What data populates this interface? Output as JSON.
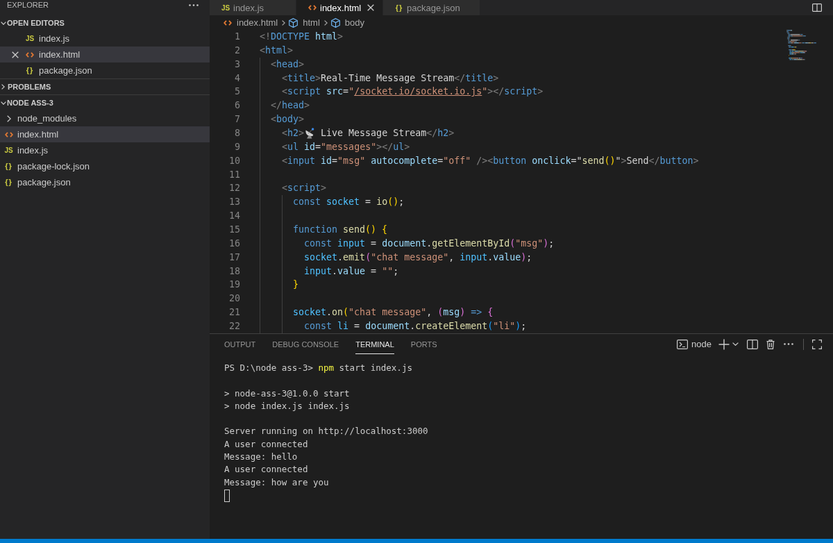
{
  "sidebar": {
    "title": "EXPLORER",
    "sections": [
      {
        "kind": "editors",
        "title": "OPEN EDITORS",
        "expanded": true,
        "items": [
          {
            "kind": "js",
            "icon": "JS",
            "name": "index.js",
            "selected": false
          },
          {
            "kind": "html",
            "name": "index.html",
            "selected": true
          },
          {
            "kind": "json",
            "icon": "{}",
            "name": "package.json",
            "selected": false
          }
        ]
      },
      {
        "kind": "problems",
        "title": "PROBLEMS",
        "expanded": false
      },
      {
        "kind": "tree",
        "title": "NODE ASS-3",
        "expanded": true,
        "items": [
          {
            "kind": "folder",
            "name": "node_modules",
            "expanded": false,
            "selected": false
          },
          {
            "kind": "html",
            "name": "index.html",
            "selected": true
          },
          {
            "kind": "js",
            "icon": "JS",
            "name": "index.js",
            "selected": false
          },
          {
            "kind": "json",
            "icon": "{}",
            "name": "package-lock.json",
            "selected": false
          },
          {
            "kind": "json",
            "icon": "{}",
            "name": "package.json",
            "selected": false
          }
        ]
      }
    ]
  },
  "editor": {
    "tabs": [
      {
        "kind": "js",
        "icon": "JS",
        "label": "index.js",
        "selected": false
      },
      {
        "kind": "html",
        "label": "index.html",
        "selected": true
      },
      {
        "kind": "json",
        "icon": "{}",
        "label": "package.json",
        "selected": false
      }
    ],
    "breadcrumbs": [
      {
        "kind": "file",
        "label": "index.html"
      },
      {
        "kind": "element",
        "label": "html"
      },
      {
        "kind": "element",
        "label": "body"
      }
    ],
    "code": [
      {
        "n": "1",
        "segments": [
          {
            "kind": "p",
            "text": "<!"
          },
          {
            "kind": "tag",
            "text": "DOCTYPE"
          },
          {
            "kind": "attr",
            "text": " html"
          },
          {
            "kind": "p",
            "text": ">"
          }
        ]
      },
      {
        "n": "2",
        "segments": [
          {
            "kind": "p",
            "text": "<"
          },
          {
            "kind": "tag",
            "text": "html"
          },
          {
            "kind": "p",
            "text": ">"
          }
        ]
      },
      {
        "n": "3",
        "segments": [
          {
            "kind": "p",
            "text": "  <"
          },
          {
            "kind": "tag",
            "text": "head"
          },
          {
            "kind": "p",
            "text": ">"
          }
        ]
      },
      {
        "n": "4",
        "segments": [
          {
            "kind": "p",
            "text": "    <"
          },
          {
            "kind": "tag",
            "text": "title"
          },
          {
            "kind": "p",
            "text": ">"
          },
          {
            "kind": "text",
            "text": "Real-Time Message Stream"
          },
          {
            "kind": "p",
            "text": "</"
          },
          {
            "kind": "tag",
            "text": "title"
          },
          {
            "kind": "p",
            "text": ">"
          }
        ]
      },
      {
        "n": "5",
        "segments": [
          {
            "kind": "p",
            "text": "    <"
          },
          {
            "kind": "tag",
            "text": "script"
          },
          {
            "kind": "attr",
            "text": " src"
          },
          {
            "kind": "op",
            "text": "="
          },
          {
            "kind": "str",
            "text": "\""
          },
          {
            "kind": "link",
            "text": "/socket.io/socket.io.js"
          },
          {
            "kind": "str",
            "text": "\""
          },
          {
            "kind": "p",
            "text": "></"
          },
          {
            "kind": "tag",
            "text": "script"
          },
          {
            "kind": "p",
            "text": ">"
          }
        ]
      },
      {
        "n": "6",
        "segments": [
          {
            "kind": "p",
            "text": "  </"
          },
          {
            "kind": "tag",
            "text": "head"
          },
          {
            "kind": "p",
            "text": ">"
          }
        ]
      },
      {
        "n": "7",
        "segments": [
          {
            "kind": "p",
            "text": "  <"
          },
          {
            "kind": "tag",
            "text": "body"
          },
          {
            "kind": "p",
            "text": ">"
          }
        ]
      },
      {
        "n": "8",
        "segments": [
          {
            "kind": "p",
            "text": "    <"
          },
          {
            "kind": "tag",
            "text": "h2"
          },
          {
            "kind": "p",
            "text": ">"
          },
          {
            "kind": "icon"
          },
          {
            "kind": "text",
            "text": " Live Message Stream"
          },
          {
            "kind": "p",
            "text": "</"
          },
          {
            "kind": "tag",
            "text": "h2"
          },
          {
            "kind": "p",
            "text": ">"
          }
        ]
      },
      {
        "n": "9",
        "segments": [
          {
            "kind": "p",
            "text": "    <"
          },
          {
            "kind": "tag",
            "text": "ul"
          },
          {
            "kind": "attr",
            "text": " id"
          },
          {
            "kind": "op",
            "text": "="
          },
          {
            "kind": "str",
            "text": "\"messages\""
          },
          {
            "kind": "p",
            "text": "></"
          },
          {
            "kind": "tag",
            "text": "ul"
          },
          {
            "kind": "p",
            "text": ">"
          }
        ]
      },
      {
        "n": "10",
        "segments": [
          {
            "kind": "p",
            "text": "    <"
          },
          {
            "kind": "tag",
            "text": "input"
          },
          {
            "kind": "attr",
            "text": " id"
          },
          {
            "kind": "op",
            "text": "="
          },
          {
            "kind": "str",
            "text": "\"msg\""
          },
          {
            "kind": "attr",
            "text": " autocomplete"
          },
          {
            "kind": "op",
            "text": "="
          },
          {
            "kind": "str",
            "text": "\"off\""
          },
          {
            "kind": "p",
            "text": " /><"
          },
          {
            "kind": "tag",
            "text": "button"
          },
          {
            "kind": "attr",
            "text": " onclick"
          },
          {
            "kind": "op",
            "text": "=\""
          },
          {
            "kind": "fn",
            "text": "send"
          },
          {
            "kind": "b1",
            "text": "()"
          },
          {
            "kind": "op",
            "text": "\""
          },
          {
            "kind": "p",
            "text": ">"
          },
          {
            "kind": "text",
            "text": "Send"
          },
          {
            "kind": "p",
            "text": "</"
          },
          {
            "kind": "tag",
            "text": "button"
          },
          {
            "kind": "p",
            "text": ">"
          }
        ]
      },
      {
        "n": "11"
      },
      {
        "n": "12",
        "segments": [
          {
            "kind": "p",
            "text": "    <"
          },
          {
            "kind": "tag",
            "text": "script"
          },
          {
            "kind": "p",
            "text": ">"
          }
        ]
      },
      {
        "n": "13",
        "segments": [
          {
            "kind": "kw",
            "text": "      const"
          },
          {
            "kind": "cvar",
            "text": " socket"
          },
          {
            "kind": "op",
            "text": " = "
          },
          {
            "kind": "fn",
            "text": "io"
          },
          {
            "kind": "b1",
            "text": "()"
          },
          {
            "kind": "op",
            "text": ";"
          }
        ]
      },
      {
        "n": "14"
      },
      {
        "n": "15",
        "segments": [
          {
            "kind": "kw",
            "text": "      function"
          },
          {
            "kind": "fn",
            "text": " send"
          },
          {
            "kind": "b1",
            "text": "() {"
          }
        ]
      },
      {
        "n": "16",
        "segments": [
          {
            "kind": "kw",
            "text": "        const"
          },
          {
            "kind": "cvar",
            "text": " input"
          },
          {
            "kind": "op",
            "text": " = "
          },
          {
            "kind": "var",
            "text": "document"
          },
          {
            "kind": "op",
            "text": "."
          },
          {
            "kind": "fn",
            "text": "getElementById"
          },
          {
            "kind": "b2",
            "text": "("
          },
          {
            "kind": "str",
            "text": "\"msg\""
          },
          {
            "kind": "b2",
            "text": ")"
          },
          {
            "kind": "op",
            "text": ";"
          }
        ]
      },
      {
        "n": "17",
        "segments": [
          {
            "kind": "cvar",
            "text": "        socket"
          },
          {
            "kind": "op",
            "text": "."
          },
          {
            "kind": "fn",
            "text": "emit"
          },
          {
            "kind": "b2",
            "text": "("
          },
          {
            "kind": "str",
            "text": "\"chat message\""
          },
          {
            "kind": "op",
            "text": ", "
          },
          {
            "kind": "cvar",
            "text": "input"
          },
          {
            "kind": "op",
            "text": "."
          },
          {
            "kind": "var",
            "text": "value"
          },
          {
            "kind": "b2",
            "text": ")"
          },
          {
            "kind": "op",
            "text": ";"
          }
        ]
      },
      {
        "n": "18",
        "segments": [
          {
            "kind": "cvar",
            "text": "        input"
          },
          {
            "kind": "op",
            "text": "."
          },
          {
            "kind": "var",
            "text": "value"
          },
          {
            "kind": "op",
            "text": " = "
          },
          {
            "kind": "str",
            "text": "\"\""
          },
          {
            "kind": "op",
            "text": ";"
          }
        ]
      },
      {
        "n": "19",
        "segments": [
          {
            "kind": "b1",
            "text": "      }"
          }
        ]
      },
      {
        "n": "20"
      },
      {
        "n": "21",
        "segments": [
          {
            "kind": "cvar",
            "text": "      socket"
          },
          {
            "kind": "op",
            "text": "."
          },
          {
            "kind": "fn",
            "text": "on"
          },
          {
            "kind": "b1",
            "text": "("
          },
          {
            "kind": "str",
            "text": "\"chat message\""
          },
          {
            "kind": "op",
            "text": ", "
          },
          {
            "kind": "b2",
            "text": "("
          },
          {
            "kind": "var",
            "text": "msg"
          },
          {
            "kind": "b2",
            "text": ")"
          },
          {
            "kind": "kw",
            "text": " => "
          },
          {
            "kind": "b2",
            "text": "{"
          }
        ]
      },
      {
        "n": "22",
        "segments": [
          {
            "kind": "kw",
            "text": "        const"
          },
          {
            "kind": "cvar",
            "text": " li"
          },
          {
            "kind": "op",
            "text": " = "
          },
          {
            "kind": "var",
            "text": "document"
          },
          {
            "kind": "op",
            "text": "."
          },
          {
            "kind": "fn",
            "text": "createElement"
          },
          {
            "kind": "b3",
            "text": "("
          },
          {
            "kind": "str",
            "text": "\"li\""
          },
          {
            "kind": "b3",
            "text": ")"
          },
          {
            "kind": "op",
            "text": ";"
          }
        ]
      }
    ]
  },
  "panel": {
    "tabs": [
      {
        "label": "OUTPUT",
        "selected": false
      },
      {
        "label": "DEBUG CONSOLE",
        "selected": false
      },
      {
        "label": "TERMINAL",
        "selected": true
      },
      {
        "label": "PORTS",
        "selected": false
      }
    ],
    "terminal": {
      "name": "node",
      "prompt": "PS D:\\node ass-3>",
      "command": "npm",
      "args": "start index.js",
      "output": [
        [
          "> node-ass-3@1.0.0 start",
          "> node index.js index.js"
        ],
        [
          "Server running on http://localhost:3000",
          "A user connected",
          "Message: hello",
          "A user connected",
          "Message: how are you"
        ]
      ]
    }
  }
}
